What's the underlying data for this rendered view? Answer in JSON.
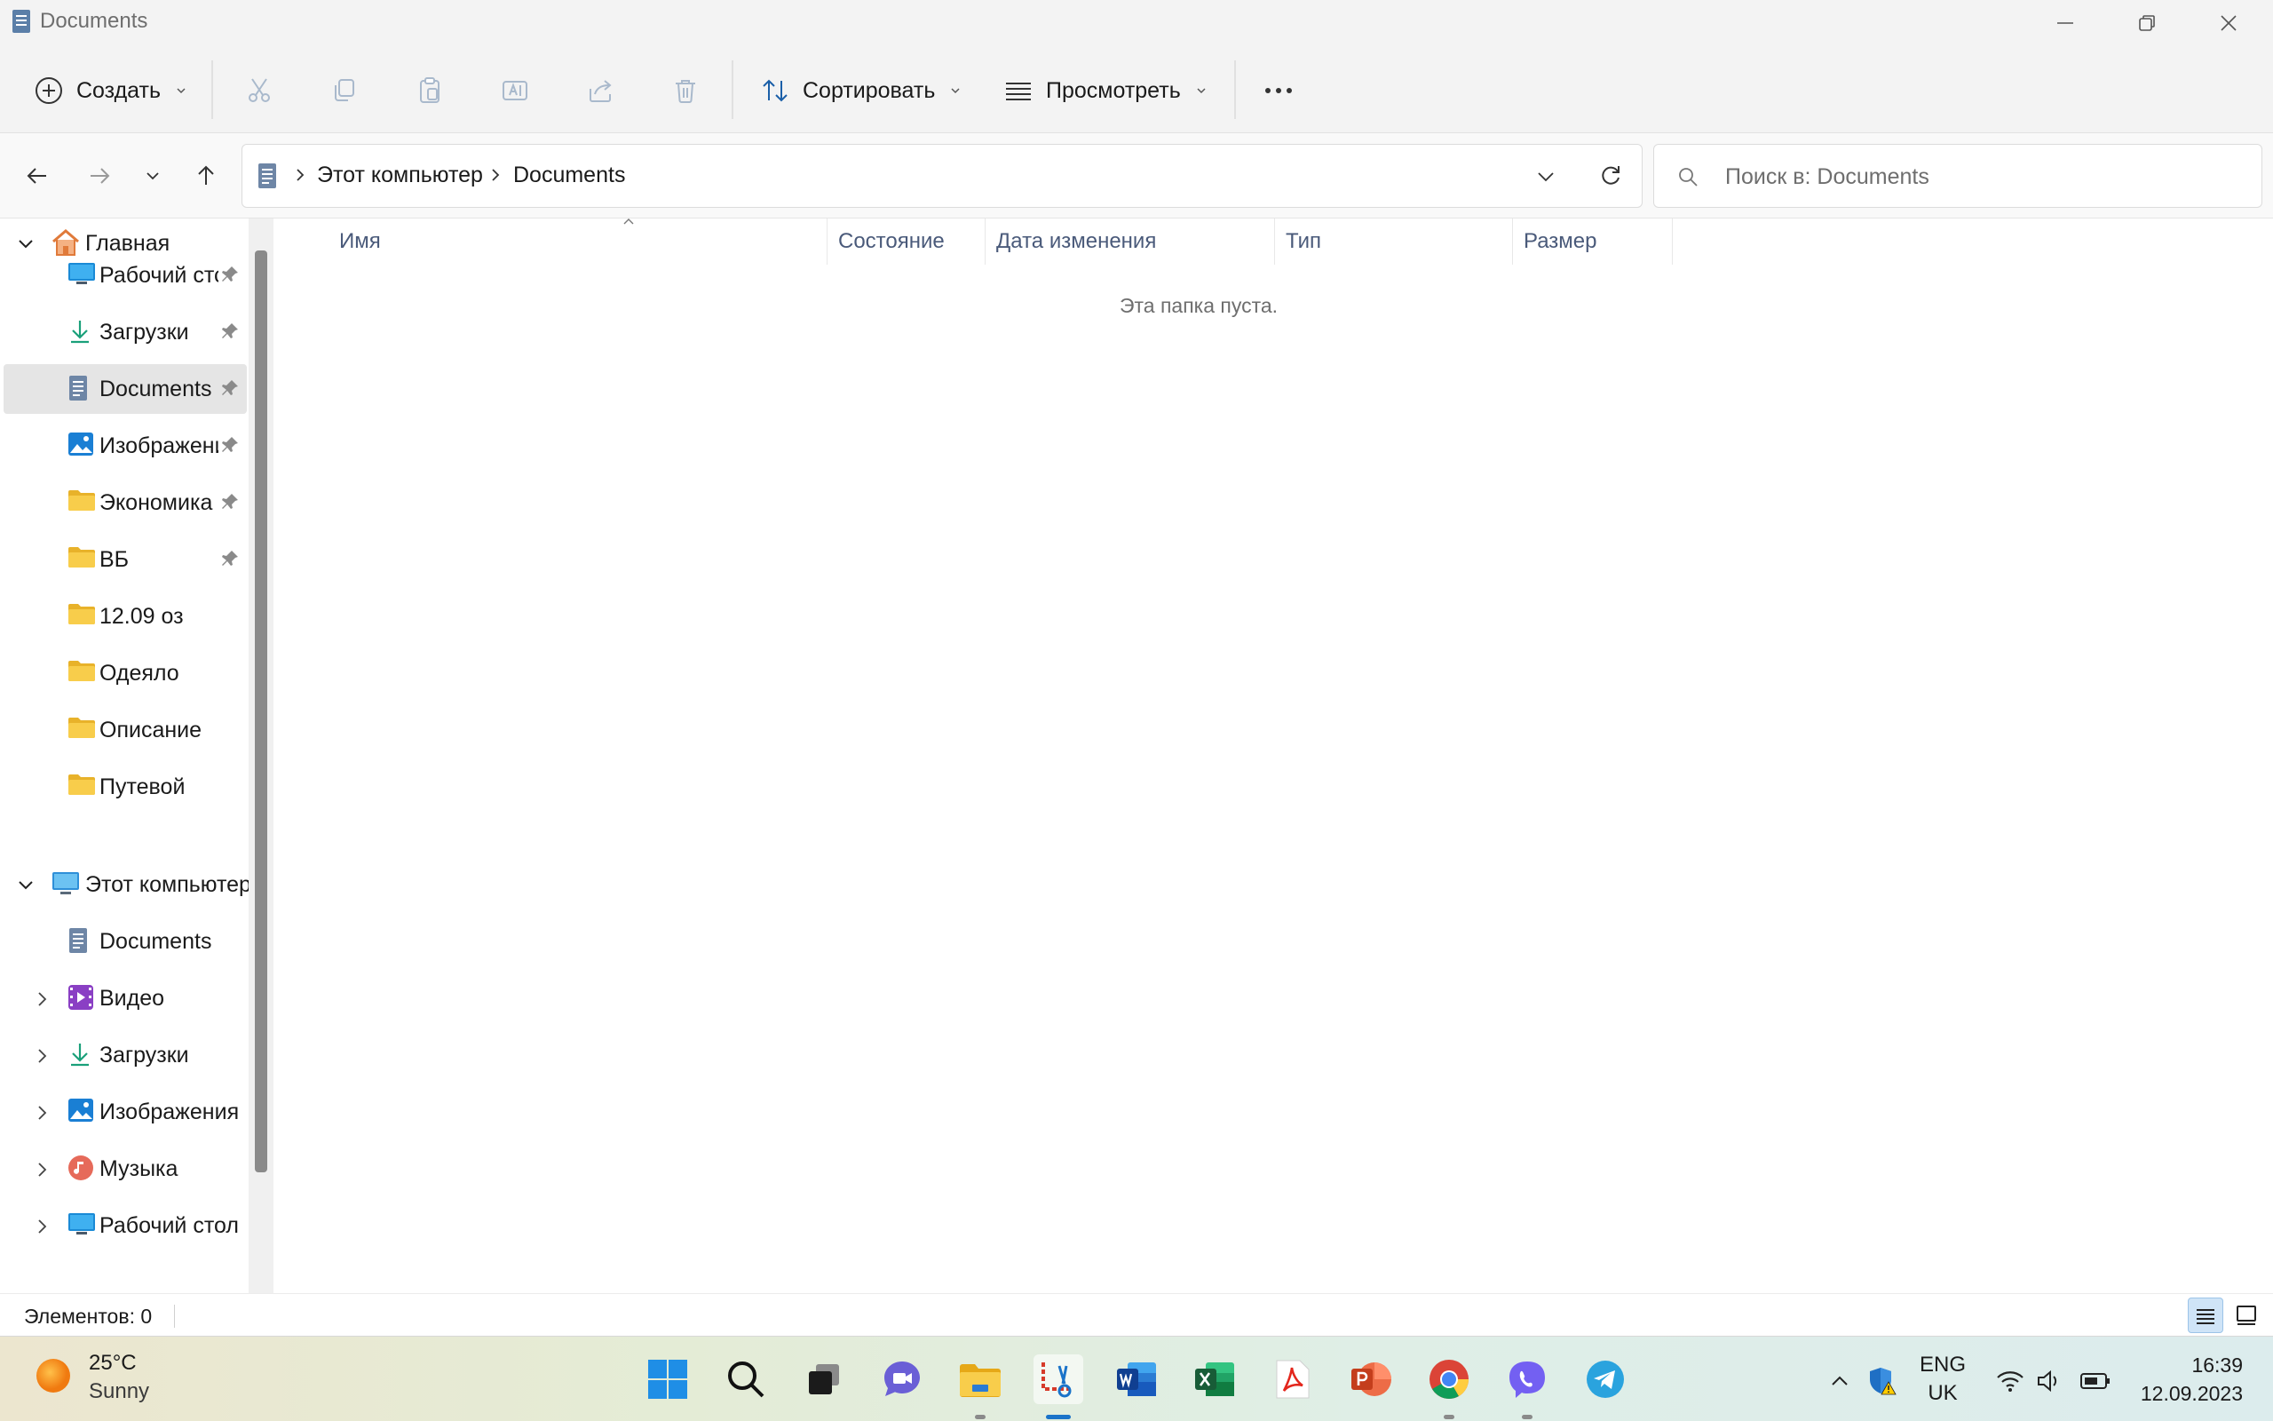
{
  "window": {
    "title": "Documents",
    "minimize_icon": "minimize-icon",
    "restore_icon": "restore-icon",
    "close_icon": "close-icon"
  },
  "toolbar": {
    "new_label": "Создать",
    "sort_label": "Сортировать",
    "view_label": "Просмотреть",
    "icons": [
      "cut-icon",
      "copy-icon",
      "paste-icon",
      "rename-icon",
      "share-icon",
      "delete-icon",
      "more-icon"
    ]
  },
  "address": {
    "crumbs": [
      "Этот компьютер",
      "Documents"
    ],
    "search_placeholder": "Поиск в: Documents"
  },
  "sidebar": {
    "home_label": "Главная",
    "quick_access": [
      {
        "label": "Рабочий стс",
        "icon": "desktop-icon",
        "pinned": true
      },
      {
        "label": "Загрузки",
        "icon": "download-icon",
        "pinned": true
      },
      {
        "label": "Documents",
        "icon": "documents-icon",
        "pinned": true,
        "selected": true
      },
      {
        "label": "Изображени",
        "icon": "pictures-icon",
        "pinned": true
      },
      {
        "label": "Экономика",
        "icon": "folder-icon",
        "pinned": true
      },
      {
        "label": "ВБ",
        "icon": "folder-icon",
        "pinned": true
      },
      {
        "label": "12.09 оз",
        "icon": "folder-icon",
        "pinned": false
      },
      {
        "label": "Одеяло",
        "icon": "folder-icon",
        "pinned": false
      },
      {
        "label": "Описание",
        "icon": "folder-icon",
        "pinned": false
      },
      {
        "label": "Путевой",
        "icon": "folder-icon",
        "pinned": false
      }
    ],
    "this_pc_label": "Этот компьютер",
    "this_pc_items": [
      {
        "label": "Documents",
        "icon": "documents-icon",
        "expandable": false
      },
      {
        "label": "Видео",
        "icon": "video-icon",
        "expandable": true
      },
      {
        "label": "Загрузки",
        "icon": "download-icon",
        "expandable": true
      },
      {
        "label": "Изображения",
        "icon": "pictures-icon",
        "expandable": true
      },
      {
        "label": "Музыка",
        "icon": "music-icon",
        "expandable": true
      },
      {
        "label": "Рабочий стол",
        "icon": "desktop-icon",
        "expandable": true
      }
    ]
  },
  "content": {
    "columns": [
      "Имя",
      "Состояние",
      "Дата изменения",
      "Тип",
      "Размер"
    ],
    "empty_message": "Эта папка пуста."
  },
  "status": {
    "items_count": "Элементов: 0"
  },
  "taskbar": {
    "weather_temp": "25°C",
    "weather_desc": "Sunny",
    "apps": [
      "windows-start-icon",
      "search-icon",
      "task-view-icon",
      "chat-icon",
      "file-explorer-icon",
      "snipping-tool-icon",
      "word-icon",
      "excel-icon",
      "acrobat-icon",
      "powerpoint-icon",
      "chrome-icon",
      "viber-icon",
      "telegram-icon"
    ],
    "lang_top": "ENG",
    "lang_bottom": "UK",
    "time": "16:39",
    "date": "12.09.2023"
  },
  "colors": {
    "accent": "#0067c0",
    "folder": "#f6c94a",
    "chrome_bg": "#f3f3f3"
  }
}
